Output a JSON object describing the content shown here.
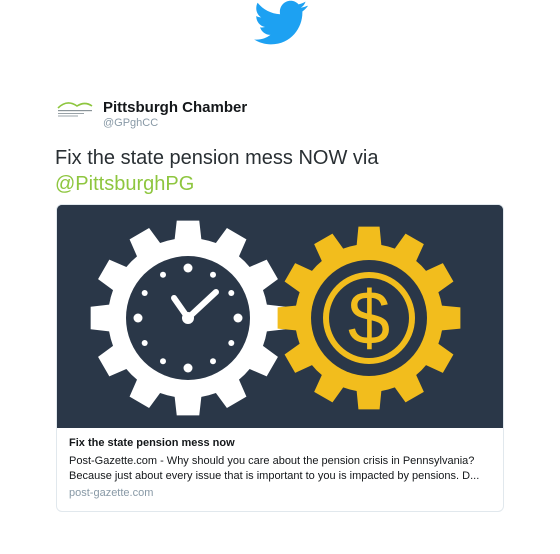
{
  "brand": {
    "bird_color": "#1da1f2"
  },
  "author": {
    "display_name": "Pittsburgh Chamber",
    "handle": "@GPghCC"
  },
  "tweet": {
    "text_prefix": "Fix the state pension mess NOW via ",
    "mention": "@PittsburghPG"
  },
  "card": {
    "title": "Fix the state pension mess now",
    "description": "Post-Gazette.com - Why should you care about the pension crisis in Pennsylvania? Because just about every issue that is important to you is impacted by pensions. D...",
    "domain": "post-gazette.com",
    "image_colors": {
      "background": "#2a3748",
      "white_gear": "#ffffff",
      "gold_gear": "#f2bd1d"
    }
  }
}
